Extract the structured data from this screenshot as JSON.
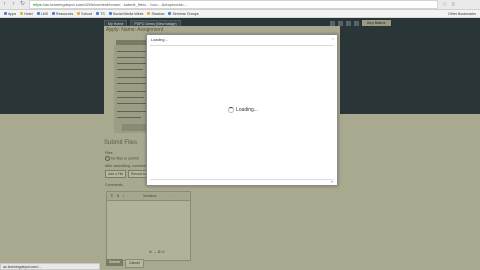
{
  "browser": {
    "url_scheme": "https://",
    "url_rest": "ac.learningdepot.com/d2l/le/content/home/...submit_files/...?ou=...&dropboxId=...",
    "bookmarks": [
      {
        "label": "Apps",
        "color": "#4a7fd4"
      },
      {
        "label": "Hotel",
        "color": "#e0b040"
      },
      {
        "label": "LMS",
        "color": "#4a7fd4"
      },
      {
        "label": "Resources",
        "color": "#4a7fd4"
      },
      {
        "label": "School",
        "color": "#e0b040"
      },
      {
        "label": "TS",
        "color": "#4a7fd4"
      },
      {
        "label": "Social Media Week",
        "color": "#4a7fd4"
      },
      {
        "label": "Shadow",
        "color": "#e0b040"
      },
      {
        "label": "Seminar Groups",
        "color": "#4a7fd4"
      }
    ],
    "other_bookmarks": "Other Bookmarks",
    "status_text": "ac.learningdepot.com/..."
  },
  "app": {
    "tabs": [
      "My Home",
      "PDPC Demo (New badge)"
    ],
    "user_label": "Amy Baleror"
  },
  "panel": {
    "title": "Apply: Name: Assignment",
    "submit_title": "Submit Files",
    "files_label": "Files",
    "no_files": "No files to submit",
    "feedback_label": "After submitting, comments",
    "add_file": "Add a File",
    "record": "Record Audio",
    "comments_label": "Comments",
    "editor_font": "Verdana",
    "submit": "Submit",
    "cancel": "Cancel"
  },
  "dialog": {
    "title": "Loading...",
    "loading_text": "Loading...",
    "close_icon": "×"
  }
}
